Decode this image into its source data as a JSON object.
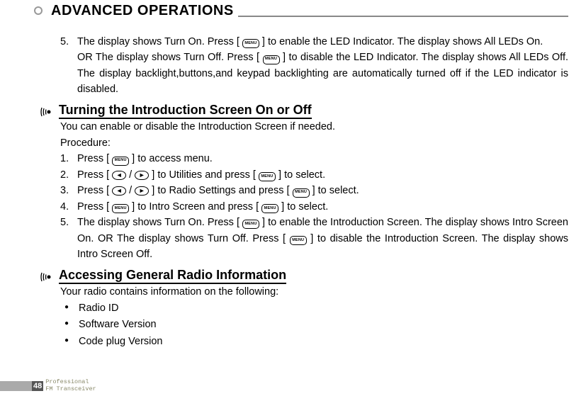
{
  "header": {
    "title": "ADVANCED OPERATIONS"
  },
  "key": {
    "menu": "MENU"
  },
  "item5a": {
    "num": "5.",
    "pre1": "The display shows Turn On. Press [ ",
    "post1": " ] to enable the LED Indicator. The display shows All LEDs On.",
    "pre2": "OR The display shows Turn Off. Press [ ",
    "post2": " ] to disable the LED Indicator. The display shows All LEDs Off. The  display  backlight,buttons,and keypad backlighting are automatically turned off if the LED indicator is disabled."
  },
  "section1": {
    "title": "Turning the Introduction Screen On or Off",
    "intro1": "You can enable or disable the  Introduction Screen if needed.",
    "intro2": "Procedure:",
    "s1": {
      "num": "1.",
      "pre": "Press [ ",
      "post": " ] to access menu."
    },
    "s2": {
      "num": "2.",
      "pre": "Press [ ",
      "mid1": " / ",
      "mid2": " ] to Utilities and press [ ",
      "post": " ] to select."
    },
    "s3": {
      "num": "3.",
      "pre": "Press [ ",
      "mid1": " / ",
      "mid2": " ] to Radio Settings and press [ ",
      "post": " ] to select."
    },
    "s4": {
      "num": "4.",
      "pre": "Press [ ",
      "mid": " ] to Intro Screen and press [ ",
      "post": " ] to select."
    },
    "s5": {
      "num": "5.",
      "pre": "The display shows Turn On. Press [ ",
      "mid": " ] to enable the Introduction Screen. The display shows Intro Screen On. OR The display shows Turn Off. Press [ ",
      "post": " ] to disable the Introduction Screen. The display shows Intro Screen Off."
    }
  },
  "section2": {
    "title": "Accessing General Radio Information",
    "intro": "Your radio contains information on the following:",
    "bullets": [
      "Radio ID",
      "Software Version",
      "Code plug Version"
    ]
  },
  "footer": {
    "page": "48",
    "line1": "Professional",
    "line2": "FM Transceiver"
  }
}
